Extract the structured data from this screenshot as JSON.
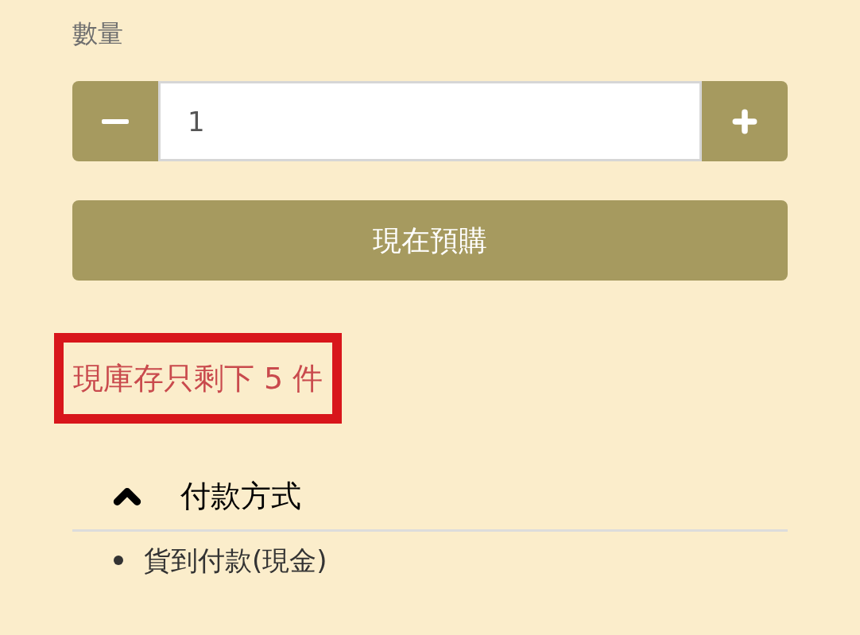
{
  "quantity": {
    "label": "數量",
    "value": "1"
  },
  "buy_button": {
    "label": "現在預購"
  },
  "stock_notice": {
    "text": "現庫存只剩下 5 件",
    "highlighted": true
  },
  "accordion": {
    "title": "付款方式",
    "expanded": true,
    "items": [
      {
        "text": "貨到付款(現金)"
      }
    ]
  }
}
